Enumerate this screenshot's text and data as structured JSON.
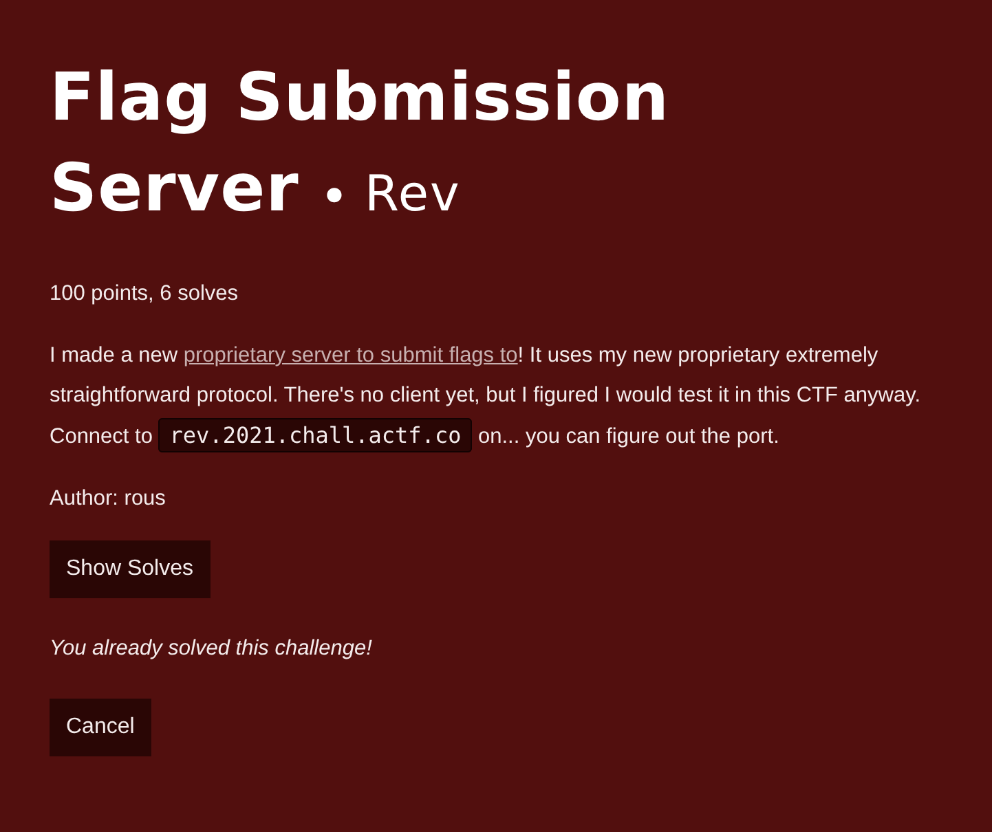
{
  "title": "Flag Submission Server",
  "separator": "•",
  "category": "Rev",
  "stats": "100 points, 6 solves",
  "description": [
    {
      "kind": "text",
      "text": "I made a new "
    },
    {
      "kind": "link",
      "text": "proprietary server to submit flags to"
    },
    {
      "kind": "text",
      "text": "! It uses my new proprietary extremely straightforward protocol. There's no client yet, but I figured I would test it in this CTF anyway. Connect to "
    },
    {
      "kind": "code",
      "text": "rev.2021.chall.actf.co"
    },
    {
      "kind": "text",
      "text": " on... you can figure out the port."
    }
  ],
  "author": "Author: rous",
  "show_solves_button": "Show Solves",
  "solved_message": "You already solved this challenge!",
  "cancel_button": "Cancel"
}
